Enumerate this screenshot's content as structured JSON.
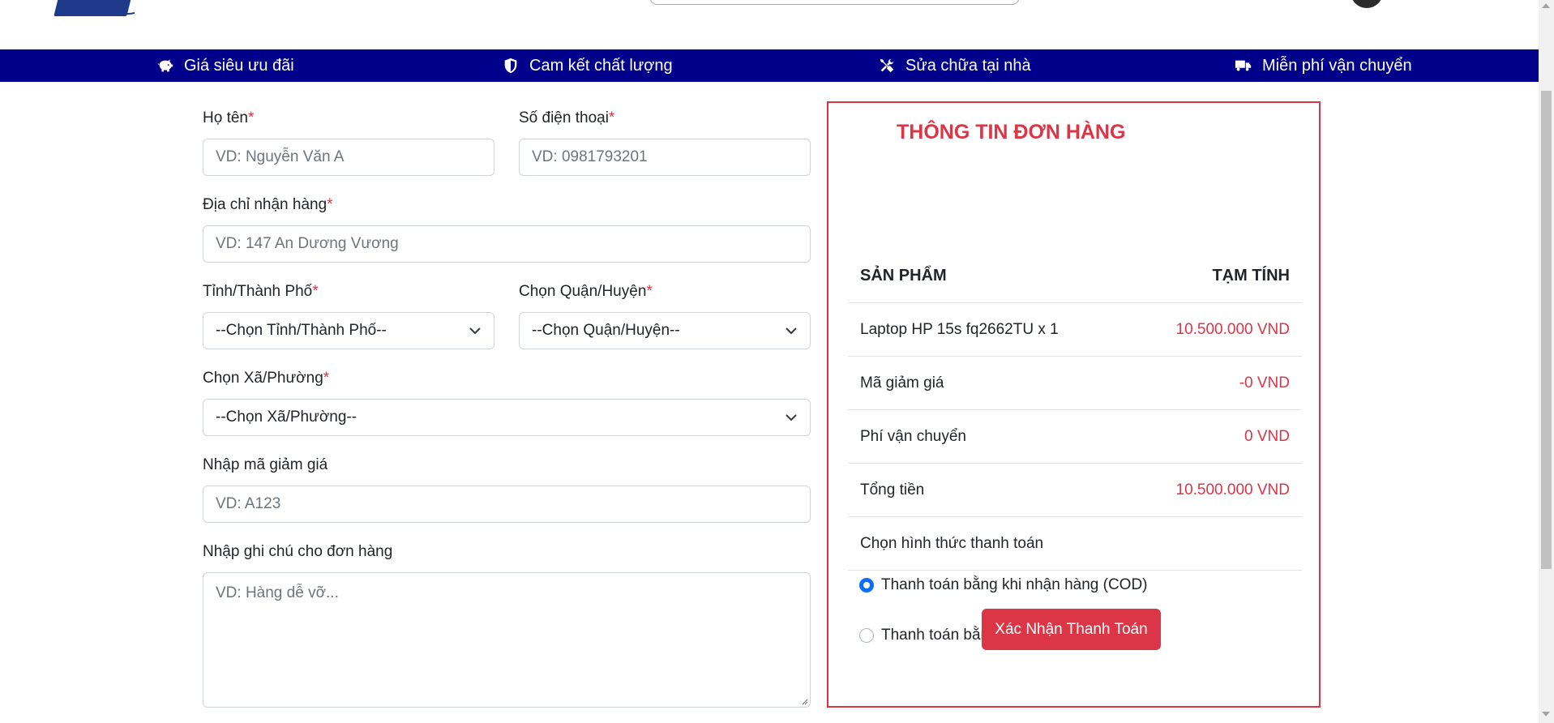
{
  "benefits": [
    {
      "icon": "piggy-bank-icon",
      "label": "Giá siêu ưu đãi"
    },
    {
      "icon": "shield-icon",
      "label": "Cam kết chất lượng"
    },
    {
      "icon": "tools-icon",
      "label": "Sửa chữa tại nhà"
    },
    {
      "icon": "truck-icon",
      "label": "Miễn phí vận chuyển"
    }
  ],
  "form": {
    "name_label": "Họ tên",
    "name_placeholder": "VD: Nguyễn Văn A",
    "phone_label": "Số điện thoại",
    "phone_placeholder": "VD: 0981793201",
    "address_label": "Địa chỉ nhận hàng",
    "address_placeholder": "VD: 147 An Dương Vương",
    "province_label": "Tỉnh/Thành Phố",
    "province_value": "--Chọn Tỉnh/Thành Phố--",
    "district_label": "Chọn Quận/Huyện",
    "district_value": "--Chọn Quận/Huyện--",
    "ward_label": "Chọn Xã/Phường",
    "ward_value": "--Chọn Xã/Phường--",
    "coupon_label": "Nhập mã giảm giá",
    "coupon_placeholder": "VD: A123",
    "note_label": "Nhập ghi chú cho đơn hàng",
    "note_placeholder": "VD: Hàng dễ vỡ...",
    "required_mark": "*"
  },
  "order": {
    "title": "THÔNG TIN ĐƠN HÀNG",
    "col_product": "SẢN PHẨM",
    "col_subtotal": "TẠM TÍNH",
    "product_name": "Laptop HP 15s fq2662TU x 1",
    "product_price": "10.500.000 VND",
    "discount_label": "Mã giảm giá",
    "discount_value": "-0 VND",
    "shipping_label": "Phí vận chuyển",
    "shipping_value": "0 VND",
    "total_label": "Tổng tiền",
    "total_value": "10.500.000 VND",
    "payment_label": "Chọn hình thức thanh toán",
    "payment_options": [
      {
        "label": "Thanh toán bằng khi nhận hàng (COD)",
        "checked": true
      },
      {
        "label": "Thanh toán bằng Internet Banking",
        "checked": false
      }
    ],
    "confirm_label": "Xác Nhận Thanh Toán"
  },
  "colors": {
    "benefit_bar": "#00008b",
    "accent_red": "#dc3545",
    "radio_checked": "#0d6efd"
  }
}
